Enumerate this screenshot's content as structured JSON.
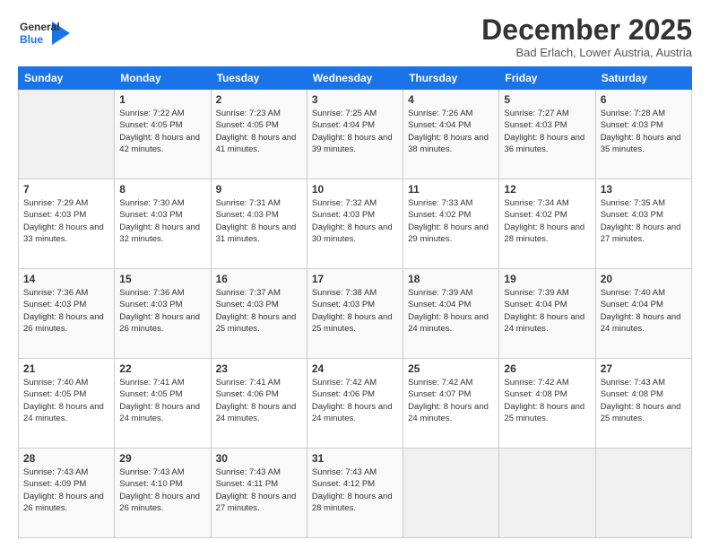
{
  "header": {
    "logo_line1": "General",
    "logo_line2": "Blue",
    "month": "December 2025",
    "location": "Bad Erlach, Lower Austria, Austria"
  },
  "weekdays": [
    "Sunday",
    "Monday",
    "Tuesday",
    "Wednesday",
    "Thursday",
    "Friday",
    "Saturday"
  ],
  "weeks": [
    [
      {
        "day": "",
        "info": ""
      },
      {
        "day": "1",
        "info": "Sunrise: 7:22 AM\nSunset: 4:05 PM\nDaylight: 8 hours\nand 42 minutes."
      },
      {
        "day": "2",
        "info": "Sunrise: 7:23 AM\nSunset: 4:05 PM\nDaylight: 8 hours\nand 41 minutes."
      },
      {
        "day": "3",
        "info": "Sunrise: 7:25 AM\nSunset: 4:04 PM\nDaylight: 8 hours\nand 39 minutes."
      },
      {
        "day": "4",
        "info": "Sunrise: 7:26 AM\nSunset: 4:04 PM\nDaylight: 8 hours\nand 38 minutes."
      },
      {
        "day": "5",
        "info": "Sunrise: 7:27 AM\nSunset: 4:03 PM\nDaylight: 8 hours\nand 36 minutes."
      },
      {
        "day": "6",
        "info": "Sunrise: 7:28 AM\nSunset: 4:03 PM\nDaylight: 8 hours\nand 35 minutes."
      }
    ],
    [
      {
        "day": "7",
        "info": "Sunrise: 7:29 AM\nSunset: 4:03 PM\nDaylight: 8 hours\nand 33 minutes."
      },
      {
        "day": "8",
        "info": "Sunrise: 7:30 AM\nSunset: 4:03 PM\nDaylight: 8 hours\nand 32 minutes."
      },
      {
        "day": "9",
        "info": "Sunrise: 7:31 AM\nSunset: 4:03 PM\nDaylight: 8 hours\nand 31 minutes."
      },
      {
        "day": "10",
        "info": "Sunrise: 7:32 AM\nSunset: 4:03 PM\nDaylight: 8 hours\nand 30 minutes."
      },
      {
        "day": "11",
        "info": "Sunrise: 7:33 AM\nSunset: 4:02 PM\nDaylight: 8 hours\nand 29 minutes."
      },
      {
        "day": "12",
        "info": "Sunrise: 7:34 AM\nSunset: 4:02 PM\nDaylight: 8 hours\nand 28 minutes."
      },
      {
        "day": "13",
        "info": "Sunrise: 7:35 AM\nSunset: 4:03 PM\nDaylight: 8 hours\nand 27 minutes."
      }
    ],
    [
      {
        "day": "14",
        "info": "Sunrise: 7:36 AM\nSunset: 4:03 PM\nDaylight: 8 hours\nand 26 minutes."
      },
      {
        "day": "15",
        "info": "Sunrise: 7:36 AM\nSunset: 4:03 PM\nDaylight: 8 hours\nand 26 minutes."
      },
      {
        "day": "16",
        "info": "Sunrise: 7:37 AM\nSunset: 4:03 PM\nDaylight: 8 hours\nand 25 minutes."
      },
      {
        "day": "17",
        "info": "Sunrise: 7:38 AM\nSunset: 4:03 PM\nDaylight: 8 hours\nand 25 minutes."
      },
      {
        "day": "18",
        "info": "Sunrise: 7:39 AM\nSunset: 4:04 PM\nDaylight: 8 hours\nand 24 minutes."
      },
      {
        "day": "19",
        "info": "Sunrise: 7:39 AM\nSunset: 4:04 PM\nDaylight: 8 hours\nand 24 minutes."
      },
      {
        "day": "20",
        "info": "Sunrise: 7:40 AM\nSunset: 4:04 PM\nDaylight: 8 hours\nand 24 minutes."
      }
    ],
    [
      {
        "day": "21",
        "info": "Sunrise: 7:40 AM\nSunset: 4:05 PM\nDaylight: 8 hours\nand 24 minutes."
      },
      {
        "day": "22",
        "info": "Sunrise: 7:41 AM\nSunset: 4:05 PM\nDaylight: 8 hours\nand 24 minutes."
      },
      {
        "day": "23",
        "info": "Sunrise: 7:41 AM\nSunset: 4:06 PM\nDaylight: 8 hours\nand 24 minutes."
      },
      {
        "day": "24",
        "info": "Sunrise: 7:42 AM\nSunset: 4:06 PM\nDaylight: 8 hours\nand 24 minutes."
      },
      {
        "day": "25",
        "info": "Sunrise: 7:42 AM\nSunset: 4:07 PM\nDaylight: 8 hours\nand 24 minutes."
      },
      {
        "day": "26",
        "info": "Sunrise: 7:42 AM\nSunset: 4:08 PM\nDaylight: 8 hours\nand 25 minutes."
      },
      {
        "day": "27",
        "info": "Sunrise: 7:43 AM\nSunset: 4:08 PM\nDaylight: 8 hours\nand 25 minutes."
      }
    ],
    [
      {
        "day": "28",
        "info": "Sunrise: 7:43 AM\nSunset: 4:09 PM\nDaylight: 8 hours\nand 26 minutes."
      },
      {
        "day": "29",
        "info": "Sunrise: 7:43 AM\nSunset: 4:10 PM\nDaylight: 8 hours\nand 26 minutes."
      },
      {
        "day": "30",
        "info": "Sunrise: 7:43 AM\nSunset: 4:11 PM\nDaylight: 8 hours\nand 27 minutes."
      },
      {
        "day": "31",
        "info": "Sunrise: 7:43 AM\nSunset: 4:12 PM\nDaylight: 8 hours\nand 28 minutes."
      },
      {
        "day": "",
        "info": ""
      },
      {
        "day": "",
        "info": ""
      },
      {
        "day": "",
        "info": ""
      }
    ]
  ]
}
